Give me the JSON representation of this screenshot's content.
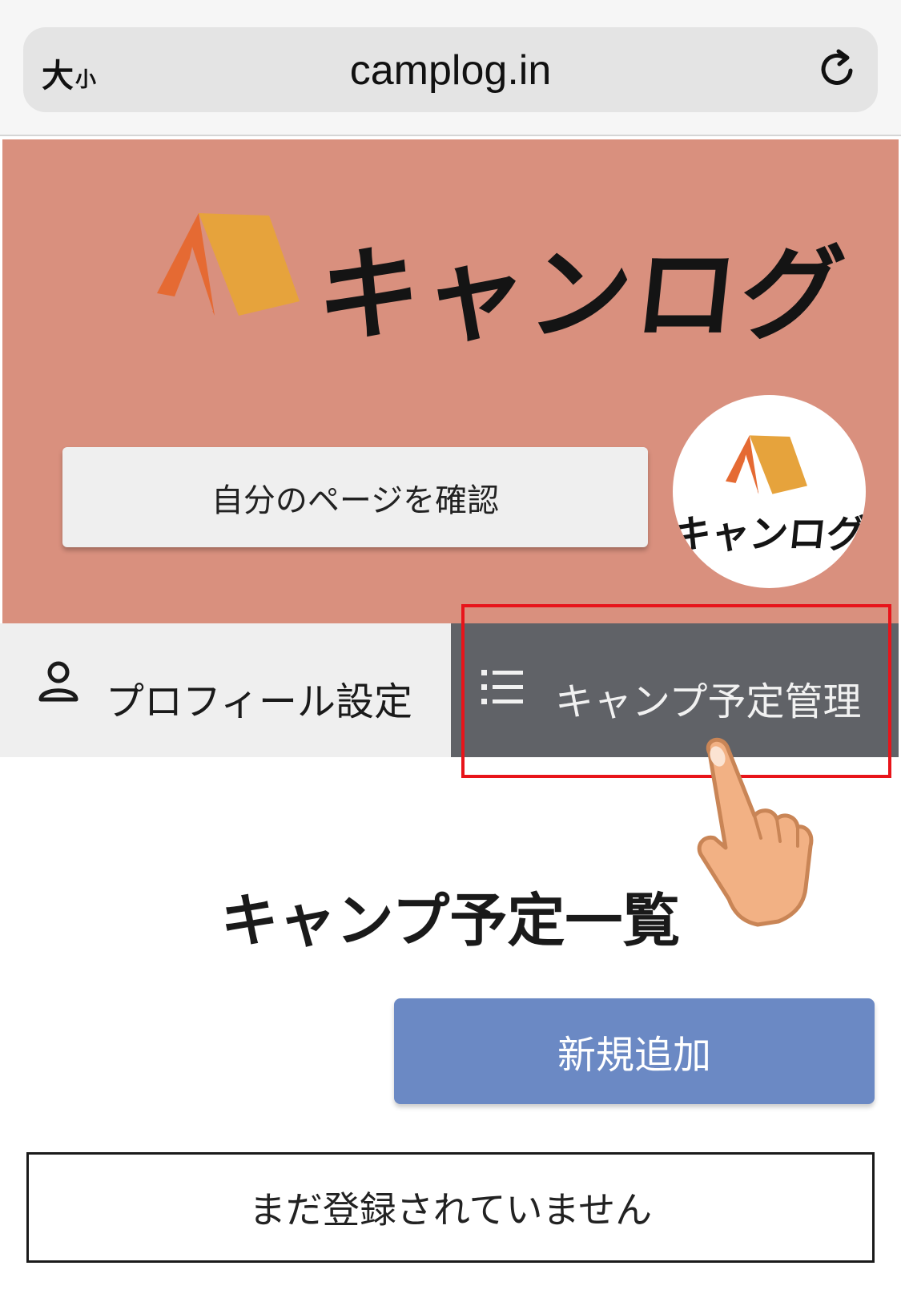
{
  "browser": {
    "text_size_big": "大",
    "text_size_small": "小",
    "url": "camplog.in"
  },
  "hero": {
    "logo_text": "キャンログ",
    "mypage_button": "自分のページを確認",
    "avatar_text": "キャンログ",
    "colors": {
      "background": "#d9907e",
      "tent_left": "#e56a33",
      "tent_right": "#e6a33c"
    }
  },
  "tabs": [
    {
      "label": "プロフィール設定",
      "icon": "user-icon",
      "active": false
    },
    {
      "label": "キャンプ予定管理",
      "icon": "list-icon",
      "active": true
    }
  ],
  "main": {
    "heading": "キャンプ予定一覧",
    "add_button": "新規追加",
    "empty_message": "まだ登録されていません"
  }
}
